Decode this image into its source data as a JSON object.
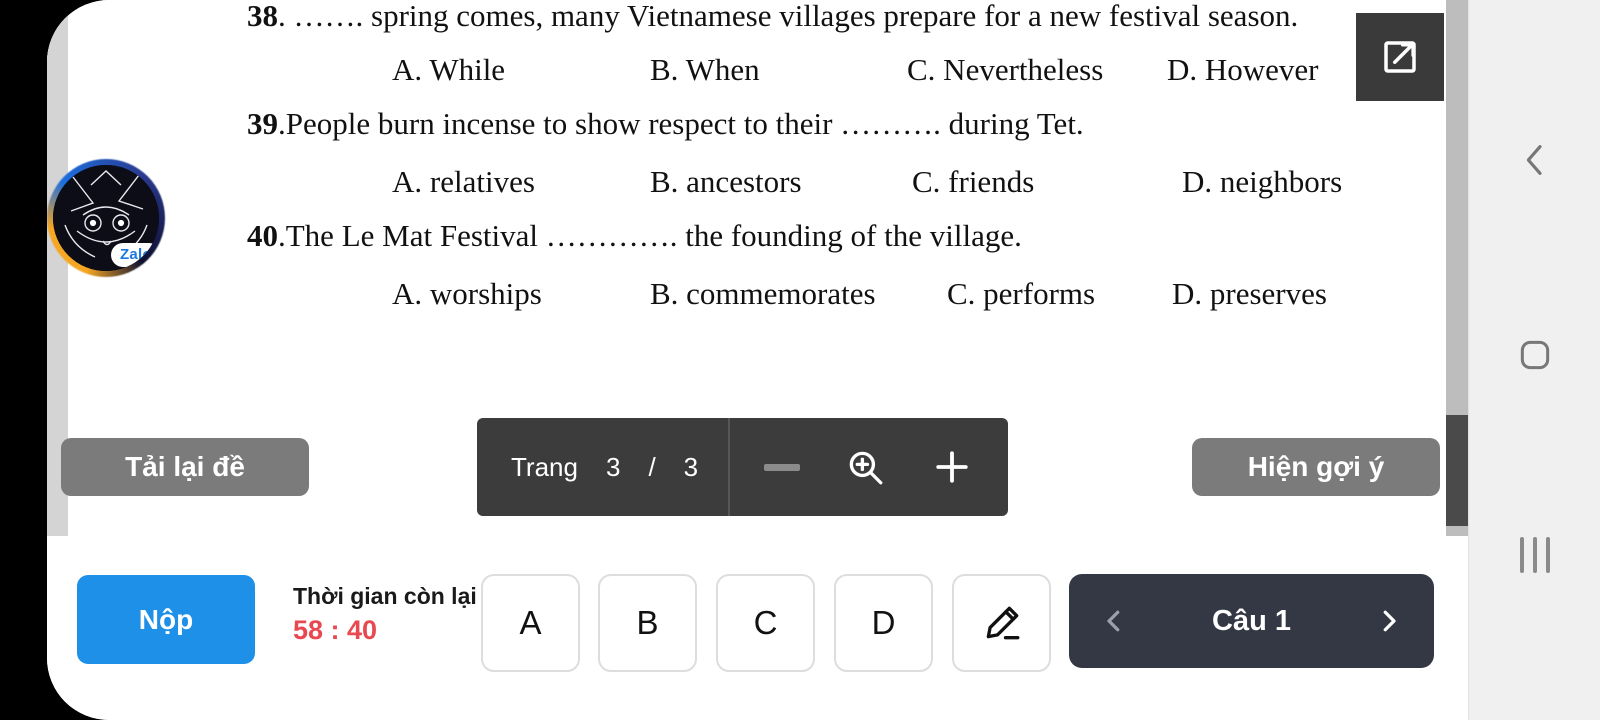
{
  "document": {
    "questions": [
      {
        "number": "38",
        "stem": ". ……. spring comes, many Vietnamese villages prepare for a new festival season.",
        "options": [
          "A. While",
          "B. When",
          "C. Nevertheless",
          "D. However"
        ]
      },
      {
        "number": "39",
        "stem": ".People burn incense to show respect to their ………. during Tet.",
        "options": [
          "A. relatives",
          "B. ancestors",
          "C. friends",
          "D. neighbors"
        ]
      },
      {
        "number": "40",
        "stem": ".The Le Mat Festival …………. the founding of the village.",
        "options": [
          "A. worships",
          "B. commemorates",
          "C. performs",
          "D. preserves"
        ]
      }
    ]
  },
  "toolbar": {
    "reload_label": "Tải lại đề",
    "hint_label": "Hiện gợi ý",
    "open_external_icon": "open-in-new-icon",
    "pager": {
      "label": "Trang",
      "current_page": "3",
      "separator": "/",
      "total_pages": "3",
      "zoom_out_icon": "minus-icon",
      "zoom_icon": "magnifier-plus-icon",
      "zoom_in_icon": "plus-icon"
    }
  },
  "bottom_bar": {
    "submit_label": "Nộp",
    "timer_label": "Thời gian còn lại",
    "timer_value": "58 : 40",
    "answer_buttons": [
      "A",
      "B",
      "C",
      "D"
    ],
    "note_icon": "pencil-icon",
    "question_nav": {
      "prev_icon": "chevron-left-icon",
      "label": "Câu 1",
      "next_icon": "chevron-right-icon"
    }
  },
  "floating": {
    "zalo_badge": "Zalo"
  },
  "android_nav": {
    "back_icon": "chevron-left-icon",
    "home_icon": "square-icon",
    "recents_icon": "recents-bars-icon"
  },
  "colors": {
    "submit_blue": "#1f90e8",
    "timer_red": "#e8484f",
    "toolbar_grey": "#7b7b7b",
    "pager_dark": "#3c3c3c",
    "nav_dark": "#343844"
  }
}
